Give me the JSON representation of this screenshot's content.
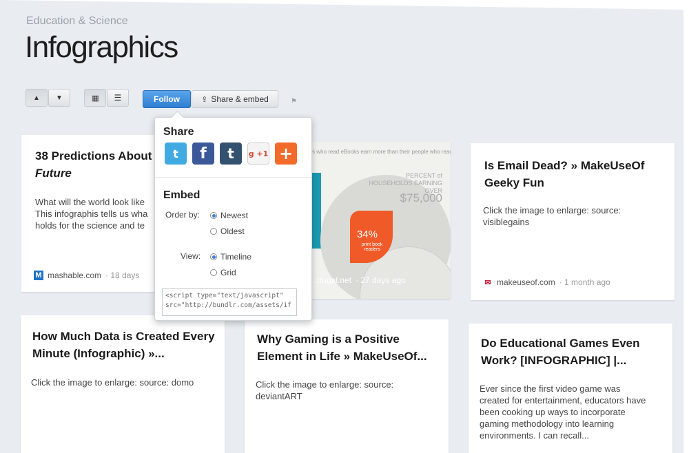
{
  "header": {
    "category": "Education & Science",
    "title": "Infographics"
  },
  "toolbar": {
    "follow_label": "Follow",
    "share_label": "Share & embed"
  },
  "popup": {
    "share_heading": "Share",
    "share_icons": [
      {
        "name": "twitter-icon",
        "glyph": "🐦",
        "color": "#41abe1"
      },
      {
        "name": "facebook-icon",
        "glyph": "f",
        "color": "#3b5998"
      },
      {
        "name": "tumblr-icon",
        "glyph": "t",
        "color": "#34526f"
      },
      {
        "name": "google-plus-one-icon",
        "glyph": "+1",
        "color": "#ffffff"
      },
      {
        "name": "add-more-icon",
        "glyph": "+",
        "color": "#f26b2a"
      }
    ],
    "embed_heading": "Embed",
    "order_by_label": "Order by:",
    "order_options": [
      "Newest",
      "Oldest"
    ],
    "order_selected": "Newest",
    "view_label": "View:",
    "view_options": [
      "Timeline",
      "Grid"
    ],
    "view_selected": "Timeline",
    "code_text": "<script type=\"text/javascript\"\nsrc=\"http://bundlr.com/assets/if"
  },
  "cards": [
    {
      "title_line1": "38 Predictions About",
      "title_line2": "Future",
      "excerpt": [
        "What will the world look like",
        "This infographis tells us wha",
        "holds for the science and te"
      ],
      "source": "mashable.com",
      "time": "· 18 days",
      "favicon": "M"
    },
    {
      "image_caption_top": "% who read eBooks earn more than their people who read print books",
      "image_heading": "PERCENT of HOUSEHOLDS EARNING OVER",
      "image_amount": "$75,000",
      "image_pct": "34%",
      "image_pct_label": "print book readers",
      "source": "...rtugal.net",
      "time": "· 27 days ago"
    },
    {
      "title": "Is Email Dead? » MakeUseOf Geeky Fun",
      "excerpt": "Click the image to enlarge: source: visiblegains",
      "source": "makeuseof.com",
      "time": "· 1 month ago"
    },
    {
      "title": "How Much Data is Created Every Minute (Infographic) »...",
      "excerpt": "Click the image to enlarge: source: domo"
    },
    {
      "title": "Why Gaming is a Positive Element in Life » MakeUseOf...",
      "excerpt": "Click the image to enlarge: source: deviantART"
    },
    {
      "title": "Do Educational Games Even Work? [INFOGRAPHIC] |...",
      "excerpt": "Ever since the first video game was created for entertainment, educators have been cooking up ways to incorporate gaming methodology into learning environments. I can recall..."
    }
  ]
}
